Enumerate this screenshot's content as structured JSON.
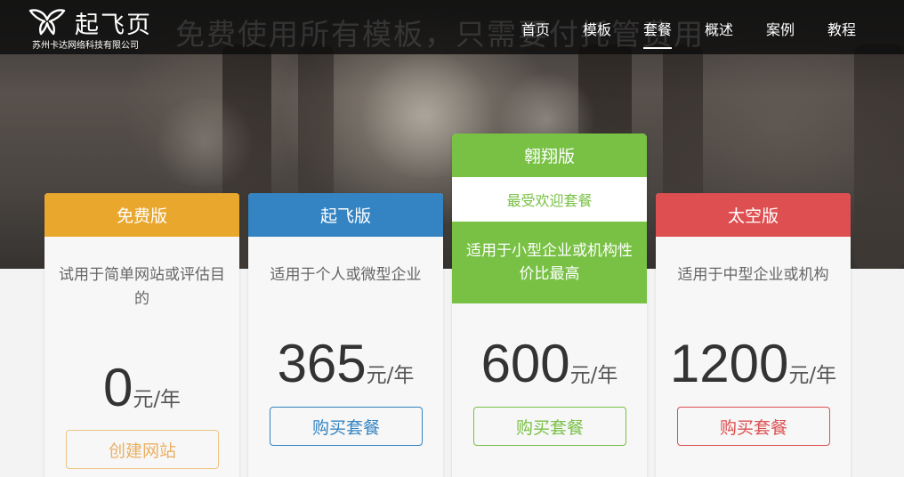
{
  "brand": {
    "name": "起飞页",
    "subtitle": "苏州卡达网络科技有限公司"
  },
  "hero": {
    "watermark": "免费使用所有模板，只需要付托管费用"
  },
  "nav": {
    "items": [
      {
        "label": "首页"
      },
      {
        "label": "模板"
      },
      {
        "label": "套餐",
        "active": true
      },
      {
        "label": "概述"
      },
      {
        "label": "案例"
      },
      {
        "label": "教程"
      }
    ]
  },
  "colors": {
    "free": "#e9a72e",
    "fly": "#3484c3",
    "soar": "#78c145",
    "space": "#de4f51"
  },
  "plans": [
    {
      "name": "免费版",
      "description": "试用于简单网站或评估目的",
      "price": "0",
      "unit": "元/年",
      "button": "创建网站"
    },
    {
      "name": "起飞版",
      "description": "适用于个人或微型企业",
      "price": "365",
      "unit": "元/年",
      "button": "购买套餐"
    },
    {
      "name": "翱翔版",
      "badge": "最受欢迎套餐",
      "description": "适用于小型企业或机构性价比最高",
      "price": "600",
      "unit": "元/年",
      "button": "购买套餐"
    },
    {
      "name": "太空版",
      "description": "适用于中型企业或机构",
      "price": "1200",
      "unit": "元/年",
      "button": "购买套餐"
    }
  ]
}
